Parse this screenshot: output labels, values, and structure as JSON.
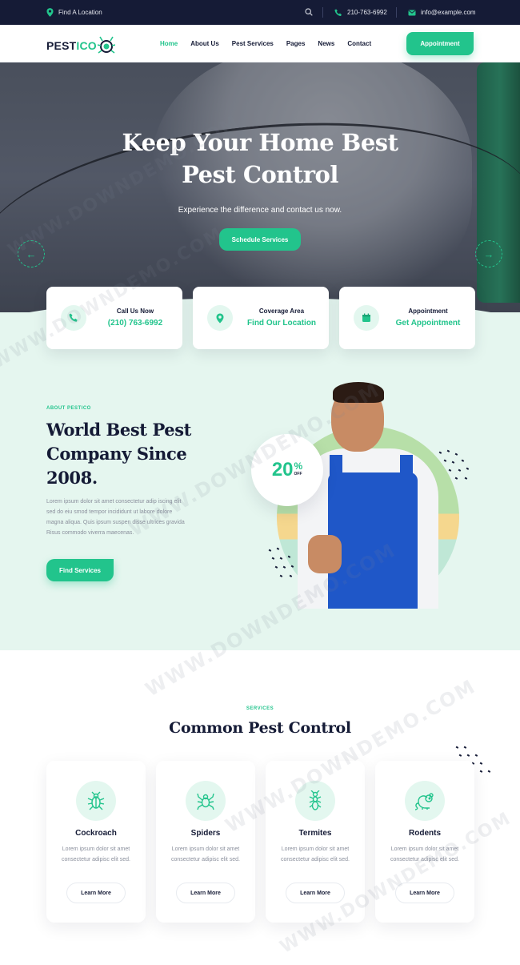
{
  "topbar": {
    "location": "Find A Location",
    "phone": "210-763-6992",
    "email": "info@example.com"
  },
  "header": {
    "logo_part1": "PEST",
    "logo_part2": "ICO",
    "nav": [
      "Home",
      "About Us",
      "Pest Services",
      "Pages",
      "News",
      "Contact"
    ],
    "active_nav": "Home",
    "appointment_label": "Appointment"
  },
  "hero": {
    "title_line1": "Keep Your Home Best",
    "title_line2": "Pest Control",
    "subtitle": "Experience the difference and contact us now.",
    "cta": "Schedule Services"
  },
  "info_cards": [
    {
      "title": "Call Us Now",
      "value": "(210) 763-6992",
      "icon": "phone-icon"
    },
    {
      "title": "Coverage Area",
      "value": "Find Our Location",
      "icon": "map-pin-icon"
    },
    {
      "title": "Appointment",
      "value": "Get Appointment",
      "icon": "calendar-icon"
    }
  ],
  "about": {
    "eyebrow": "ABOUT PESTICO",
    "title_line1": "World Best Pest",
    "title_line2": "Company Since",
    "title_line3": "2008.",
    "text": "Lorem ipsum dolor sit amet consectetur adip iscing elit sed do eiu smod tempor incididunt ut labore dolore magna aliqua. Quis ipsum suspen disse ultrices gravida Risus commodo viverra maecenas.",
    "button": "Find Services",
    "badge_value": "20",
    "badge_unit": "%",
    "badge_label": "OFF"
  },
  "services": {
    "eyebrow": "SERVICES",
    "title": "Common Pest Control",
    "items": [
      {
        "name": "Cockroach",
        "desc": "Lorem ipsum dolor sit amet consectetur adipisc elit sed.",
        "button": "Learn More",
        "icon": "cockroach-icon"
      },
      {
        "name": "Spiders",
        "desc": "Lorem ipsum dolor sit amet consectetur adipisc elit sed.",
        "button": "Learn More",
        "icon": "spider-icon"
      },
      {
        "name": "Termites",
        "desc": "Lorem ipsum dolor sit amet consectetur adipisc elit sed.",
        "button": "Learn More",
        "icon": "termite-icon"
      },
      {
        "name": "Rodents",
        "desc": "Lorem ipsum dolor sit amet consectetur adipisc elit sed.",
        "button": "Learn More",
        "icon": "rodent-icon"
      }
    ]
  },
  "watermark": "WWW.DOWNDEMO.COM",
  "colors": {
    "accent": "#22c48c",
    "dark": "#151b36",
    "mint": "#e5f6ef"
  }
}
